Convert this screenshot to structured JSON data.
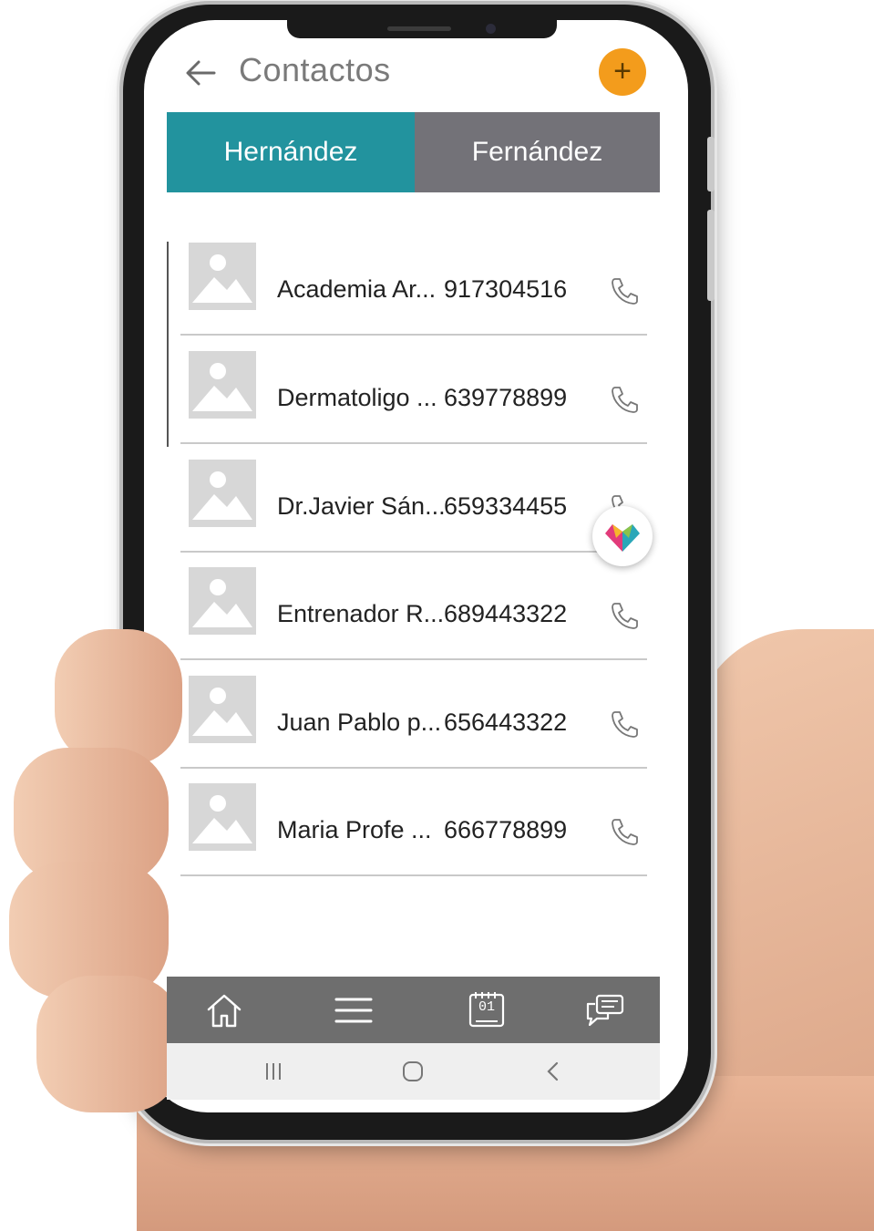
{
  "header": {
    "title": "Contactos",
    "add_label": "+"
  },
  "tabs": [
    {
      "label": "Hernández",
      "active": true,
      "color": "#22939e"
    },
    {
      "label": "Fernández",
      "active": false,
      "color": "#737278"
    }
  ],
  "contacts": [
    {
      "name": "Academia Ar...",
      "phone": "917304516"
    },
    {
      "name": "Dermatoligo ...",
      "phone": "639778899"
    },
    {
      "name": "Dr.Javier Sán...",
      "phone": "659334455"
    },
    {
      "name": "Entrenador R...",
      "phone": "689443322"
    },
    {
      "name": "Juan Pablo p...",
      "phone": "656443322"
    },
    {
      "name": "Maria Profe ...",
      "phone": "666778899"
    }
  ],
  "calendar_day": "01",
  "icons": {
    "back": "arrow-left-icon",
    "add": "plus-icon",
    "call": "phone-icon",
    "home": "home-icon",
    "menu": "menu-icon",
    "calendar": "calendar-icon",
    "chat": "chat-icon"
  },
  "colors": {
    "accent": "#f39c1c",
    "teal": "#22939e",
    "nav": "#6e6e6e"
  }
}
